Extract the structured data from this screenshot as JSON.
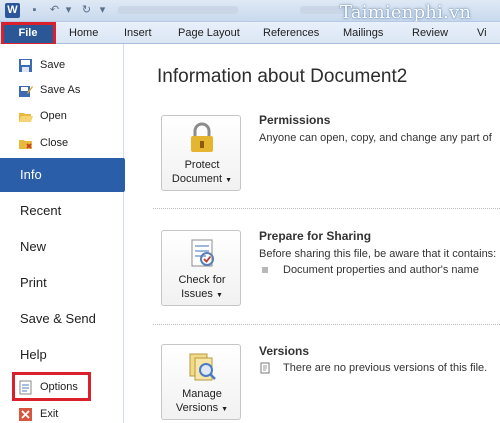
{
  "watermark": "Taimienphi.vn",
  "ribbon": {
    "file_label": "File",
    "tabs": [
      "Home",
      "Insert",
      "Page Layout",
      "References",
      "Mailings",
      "Review",
      "Vi"
    ]
  },
  "sidebar": {
    "save": "Save",
    "save_as": "Save As",
    "open": "Open",
    "close": "Close",
    "info": "Info",
    "recent": "Recent",
    "new": "New",
    "print": "Print",
    "save_send": "Save & Send",
    "help": "Help",
    "options": "Options",
    "exit": "Exit"
  },
  "main": {
    "title": "Information about Document2",
    "permissions": {
      "button_line1": "Protect",
      "button_line2": "Document",
      "heading": "Permissions",
      "desc": "Anyone can open, copy, and change any part of"
    },
    "sharing": {
      "button_line1": "Check for",
      "button_line2": "Issues",
      "heading": "Prepare for Sharing",
      "desc": "Before sharing this file, be aware that it contains:",
      "bullet": "Document properties and author's name"
    },
    "versions": {
      "button_line1": "Manage",
      "button_line2": "Versions",
      "heading": "Versions",
      "desc": "There are no previous versions of this file."
    }
  },
  "colors": {
    "file_tab": "#2b5797",
    "info_selected": "#2b5ea8",
    "highlight": "#d9202c"
  }
}
